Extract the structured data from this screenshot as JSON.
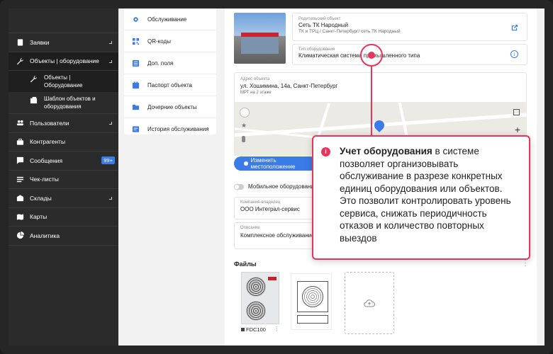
{
  "sidebar": {
    "items": [
      {
        "label": "Заявки",
        "icon": "clipboard-icon",
        "chevron": true
      },
      {
        "label": "Объекты | оборудование",
        "icon": "wrench-icon",
        "chevron": true
      },
      {
        "label": "Пользователи",
        "icon": "users-icon",
        "chevron": true
      },
      {
        "label": "Контрагенты",
        "icon": "briefcase-icon",
        "chevron": false
      },
      {
        "label": "Сообщения",
        "icon": "chat-icon",
        "chevron": false,
        "badge": "99+"
      },
      {
        "label": "Чек-листы",
        "icon": "checklist-icon",
        "chevron": false
      },
      {
        "label": "Склады",
        "icon": "warehouse-icon",
        "chevron": true
      },
      {
        "label": "Карты",
        "icon": "map-icon",
        "chevron": false
      },
      {
        "label": "Аналитика",
        "icon": "pie-chart-icon",
        "chevron": false
      }
    ],
    "sub_items": [
      {
        "label": "Объекты | Оборудование",
        "icon": "wrench-icon"
      },
      {
        "label": "Шаблон объектов и оборудования",
        "icon": "template-icon"
      }
    ]
  },
  "object_menu": [
    {
      "label": "Обслуживание",
      "icon": "settings-icon"
    },
    {
      "label": "QR-коды",
      "icon": "qr-icon"
    },
    {
      "label": "Доп. поля",
      "icon": "fields-icon"
    },
    {
      "label": "Паспорт объекта",
      "icon": "passport-icon"
    },
    {
      "label": "Дочерние объекты",
      "icon": "folder-icon"
    },
    {
      "label": "История обслуживания",
      "icon": "history-icon"
    }
  ],
  "parent_object": {
    "label": "Родительский объект",
    "value": "Сеть ТК Народный",
    "path": "ТК и ТРЦ / Санкт-Петербург/ сеть ТК Народный"
  },
  "object_type": {
    "label": "Тип оборудования",
    "value": "Климатическая система промышленного типа"
  },
  "address": {
    "label": "Адрес объекта",
    "value": "ул. Хошимина, 14а, Санкт-Петербург",
    "note": "МРТ на 2 этаже"
  },
  "location_button": "Изменить местоположение",
  "mobile_toggle_label": "Мобильное оборудование",
  "owner": {
    "label": "Компания-владелец",
    "value": "ООО Интеграл-сервис"
  },
  "description": {
    "label": "Описание",
    "value": "Комплексное обслуживание"
  },
  "files": {
    "title": "Файлы",
    "items": [
      {
        "name": "FDC100"
      }
    ]
  },
  "tooltip": {
    "title": "Учет оборудования",
    "text": " в системе позволяет организовывать обслуживание в разрезе конкретных единиц оборудования или объектов. Это позволит контролировать уровень сервиса, снижать периодичность отказов и количество повторных выездов"
  },
  "colors": {
    "accent": "#3b7be8",
    "highlight": "#e6375b",
    "sidebar": "#2b2b2b"
  }
}
